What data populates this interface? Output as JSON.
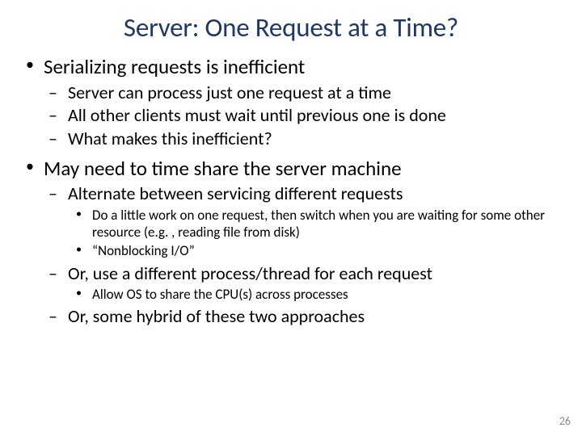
{
  "title": "Server: One Request at a Time?",
  "b1": {
    "text": "Serializing requests is inefficient",
    "sub": {
      "a": "Server can process just one request at a time",
      "b": "All other clients must wait until previous one is done",
      "c": "What makes this inefficient?"
    }
  },
  "b2": {
    "text": "May need to time share the server machine",
    "sub": {
      "a": "Alternate between servicing different requests",
      "a_sub": {
        "i": "Do a little work on one request, then switch when you are waiting for some other resource (e.g. , reading file from disk)",
        "ii": "“Nonblocking I/O”"
      },
      "b": "Or, use a different process/thread for each request",
      "b_sub": {
        "i": "Allow OS to share the CPU(s) across processes"
      },
      "c": "Or, some hybrid of these two approaches"
    }
  },
  "page": "26"
}
